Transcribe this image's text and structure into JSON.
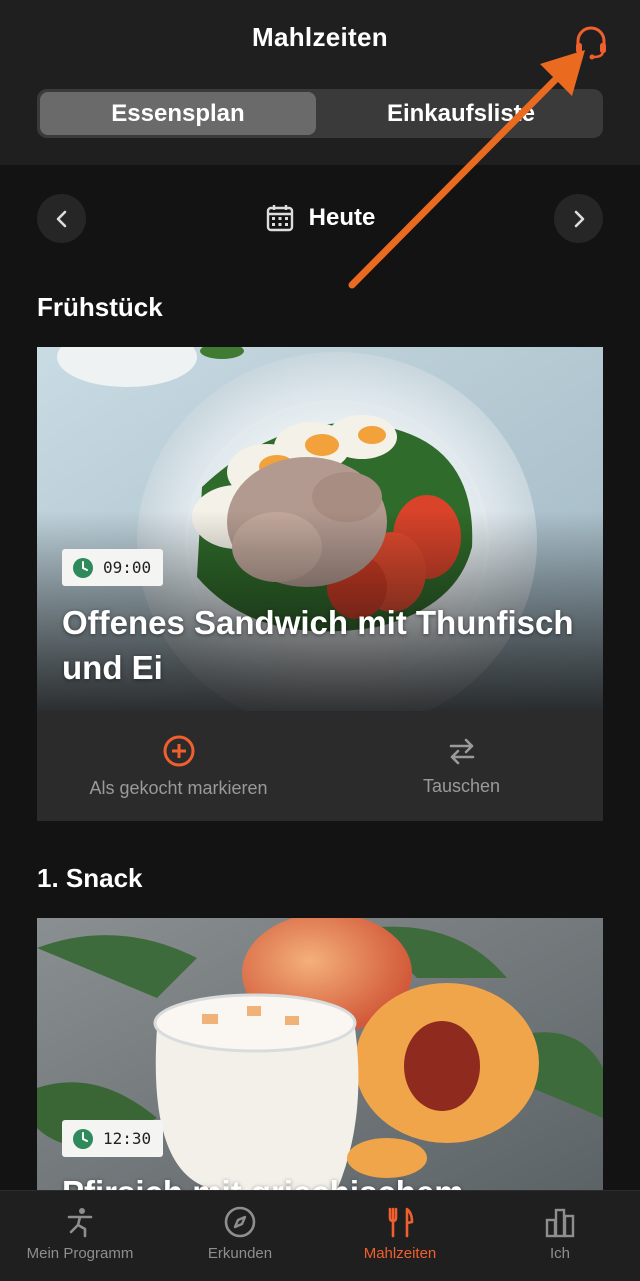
{
  "header": {
    "title": "Mahlzeiten",
    "support_icon": "headset-icon"
  },
  "segments": {
    "left": "Essensplan",
    "right": "Einkaufsliste",
    "selected": "Essensplan"
  },
  "date_nav": {
    "label": "Heute",
    "prev_icon": "chevron-left-icon",
    "next_icon": "chevron-right-icon",
    "calendar_icon": "calendar-icon"
  },
  "meals": [
    {
      "section": "Frühstück",
      "time": "09:00",
      "title": "Offenes Sandwich mit Thunfisch und Ei"
    },
    {
      "section": "1. Snack",
      "time": "12:30",
      "title": "Pfirsich mit griechischem"
    }
  ],
  "actions": {
    "mark_cooked": "Als gekocht markieren",
    "swap": "Tauschen"
  },
  "tabs": [
    {
      "label": "Mein Programm",
      "icon": "exercise-figure-icon"
    },
    {
      "label": "Erkunden",
      "icon": "compass-icon"
    },
    {
      "label": "Mahlzeiten",
      "icon": "fork-knife-icon"
    },
    {
      "label": "Ich",
      "icon": "bar-chart-icon"
    }
  ],
  "colors": {
    "accent": "#f05f2e",
    "background": "#131313",
    "surface": "#1f1f1f",
    "badge_green": "#2e8a5a"
  }
}
